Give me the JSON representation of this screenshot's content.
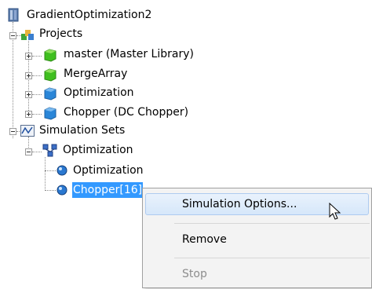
{
  "tree": {
    "root": {
      "label": "GradientOptimization2",
      "icon": "database-icon"
    },
    "projects": {
      "label": "Projects",
      "icon": "projects-folder-icon",
      "items": [
        {
          "label": "master (Master Library)",
          "icon": "green-cube-icon"
        },
        {
          "label": "MergeArray",
          "icon": "green-cube-icon"
        },
        {
          "label": "Optimization",
          "icon": "blue-cube-icon"
        },
        {
          "label": "Chopper (DC Chopper)",
          "icon": "blue-cube-icon"
        }
      ]
    },
    "simulation_sets": {
      "label": "Simulation Sets",
      "icon": "waveform-icon",
      "child": {
        "label": "Optimization",
        "icon": "optimization-set-icon",
        "items": [
          {
            "label": "Optimization",
            "icon": "blue-sphere-icon"
          },
          {
            "label": "Chopper[16]",
            "icon": "blue-sphere-icon",
            "selected": true
          }
        ]
      }
    }
  },
  "context_menu": {
    "items": [
      {
        "label": "Simulation Options...",
        "state": "hover"
      },
      {
        "label": "Remove",
        "state": "normal"
      },
      {
        "label": "Stop",
        "state": "disabled"
      }
    ]
  },
  "colors": {
    "selection": "#3399ff",
    "green": "#3fbf1f",
    "blue": "#2a86d8"
  }
}
